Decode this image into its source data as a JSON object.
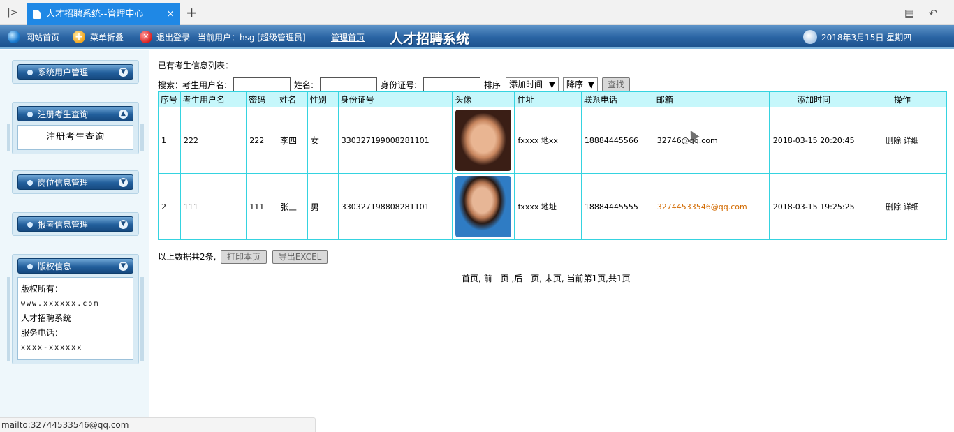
{
  "browser": {
    "active_tab_title": "人才招聘系统--管理中心",
    "close_glyph": "×",
    "new_tab_glyph": "+"
  },
  "header": {
    "site_home": "网站首页",
    "toggle_menu": "菜单折叠",
    "logout": "退出登录",
    "current_user": "当前用户：hsg [超级管理员]",
    "admin_home": "管理首页",
    "app_title": "人才招聘系统",
    "date": "2018年3月15日 星期四"
  },
  "sidebar": {
    "groups": [
      {
        "label": "系统用户管理"
      },
      {
        "label": "注册考生查询",
        "items": [
          "注册考生查询"
        ]
      },
      {
        "label": "岗位信息管理"
      },
      {
        "label": "报考信息管理"
      },
      {
        "label": "版权信息"
      }
    ],
    "copyright": {
      "line1": "版权所有：",
      "line2": "www.xxxxxx.com",
      "line3": "人才招聘系统",
      "line4": "服务电话：",
      "line5": "xxxx-xxxxxx"
    }
  },
  "main": {
    "list_title": "已有考生信息列表：",
    "search": {
      "search_label": "搜索：",
      "username_label": "考生用户名:",
      "name_label": "姓名:",
      "id_label": "身份证号:",
      "sort_label": "排序",
      "sort_field": "添加时间",
      "sort_order": "降序",
      "search_button": "查找"
    },
    "table": {
      "headers": [
        "序号",
        "考生用户名",
        "密码",
        "姓名",
        "性别",
        "身份证号",
        "头像",
        "住址",
        "联系电话",
        "邮箱",
        "添加时间",
        "操作"
      ],
      "rows": [
        {
          "no": "1",
          "username": "222",
          "password": "222",
          "name": "李四",
          "gender": "女",
          "id": "330327199008281101",
          "address": "fxxxx 地xx",
          "phone": "18884445566",
          "email": "32746@qq.com",
          "added": "2018-03-15 20:20:45",
          "delete": "删除",
          "detail": "详细"
        },
        {
          "no": "2",
          "username": "111",
          "password": "111",
          "name": "张三",
          "gender": "男",
          "id": "330327198808281101",
          "address": "fxxxx 地址",
          "phone": "18884445555",
          "email": "32744533546@qq.com",
          "added": "2018-03-15 19:25:25",
          "delete": "删除",
          "detail": "详细"
        }
      ]
    },
    "summary": "以上数据共2条,",
    "print_button": "打印本页",
    "export_button": "导出EXCEL",
    "pager": "首页, 前一页 ,后一页, 末页, 当前第1页,共1页"
  },
  "statusbar": {
    "text": "mailto:32744533546@qq.com"
  }
}
